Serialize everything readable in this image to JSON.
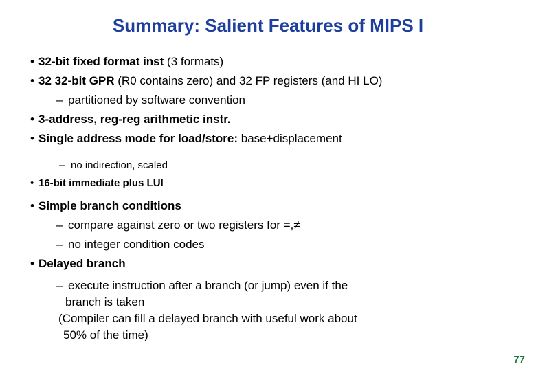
{
  "slide": {
    "title": "Summary: Salient Features of MIPS I",
    "title_color": "#1f3f9e",
    "background_color": "#ffffff",
    "page_number": "77",
    "page_number_color": "#1a7a3a",
    "bullet_glyph": "•",
    "dash_glyph": "–"
  },
  "bullets": [
    {
      "level": 1,
      "bold_text": "32-bit fixed format inst",
      "regular_text": " (3 formats)"
    },
    {
      "level": 1,
      "bold_text": "32 32-bit GPR",
      "regular_text": " (R0 contains zero)  and 32 FP registers (and HI LO)"
    },
    {
      "level": 2,
      "text": "partitioned by software convention"
    },
    {
      "level": 1,
      "bold_text": "3-address, reg-reg arithmetic instr.",
      "regular_text": ""
    },
    {
      "level": 1,
      "bold_text": "Single address mode for load/store:",
      "regular_text": " base+displacement"
    },
    {
      "level": 2,
      "text": "no indirection, scaled"
    },
    {
      "level": 1,
      "bold_text": "16-bit immediate plus LUI",
      "regular_text": ""
    },
    {
      "level": 1,
      "bold_text": "Simple branch conditions",
      "regular_text": ""
    },
    {
      "level": 2,
      "text": "compare against zero or two registers for =,≠"
    },
    {
      "level": 2,
      "text": "no integer condition codes"
    },
    {
      "level": 1,
      "bold_text": "Delayed branch",
      "regular_text": ""
    },
    {
      "level": 2,
      "text": "execute instruction after a branch (or jump) even if the"
    }
  ],
  "closing_lines": {
    "line1": "branch is taken",
    "line2": "(Compiler can fill a delayed branch with useful work about",
    "line3": " 50% of the time)"
  }
}
